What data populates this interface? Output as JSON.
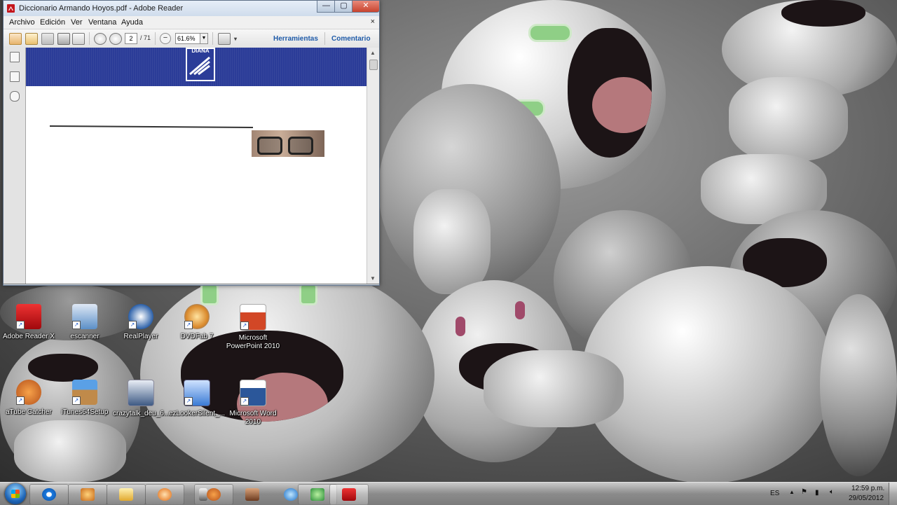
{
  "window": {
    "title": "Diccionario Armando Hoyos.pdf - Adobe Reader",
    "min_glyph": "—",
    "max_glyph": "▢",
    "close_glyph": "✕"
  },
  "menu": {
    "items": [
      "Archivo",
      "Edición",
      "Ver",
      "Ventana",
      "Ayuda"
    ],
    "doc_close": "×"
  },
  "toolbar": {
    "current_page": "2",
    "total_pages": "/ 71",
    "zoom_minus": "−",
    "zoom": "61.6%",
    "zoom_drop": "▼",
    "fit_drop": "▾",
    "tools_label": "Herramientas",
    "comment_label": "Comentario"
  },
  "document": {
    "logo_text": "DIANA"
  },
  "desktop_icons": [
    {
      "name": "adobe-reader-x",
      "label": "Adobe Reader X",
      "color": "#c4161c"
    },
    {
      "name": "escanner",
      "label": "escanner",
      "color": "#5b8fc8"
    },
    {
      "name": "realplayer",
      "label": "RealPlayer",
      "color": "#2a5fa8"
    },
    {
      "name": "dvdfab",
      "label": "DVDFab 7",
      "color": "#d9882a"
    },
    {
      "name": "powerpoint",
      "label": "Microsoft PowerPoint 2010",
      "color": "#d24726"
    },
    {
      "name": "atube-catcher",
      "label": "aTube Catcher",
      "color": "#d8691f"
    },
    {
      "name": "itunes-setup",
      "label": "iTunes64Setup",
      "color": "#b57a3a"
    },
    {
      "name": "crazytalk",
      "label": "crazytalk_deu_6....",
      "color": "#3e5a84"
    },
    {
      "name": "ezlooker",
      "label": "ezLookerSilent_...",
      "color": "#3a7bd5"
    },
    {
      "name": "word",
      "label": "Microsoft Word 2010",
      "color": "#2b579a"
    }
  ],
  "tray": {
    "language": "ES",
    "time": "12:59 p.m.",
    "date": "29/05/2012"
  },
  "colors": {
    "banner": "#2b3c98",
    "link": "#1e5aa8"
  }
}
